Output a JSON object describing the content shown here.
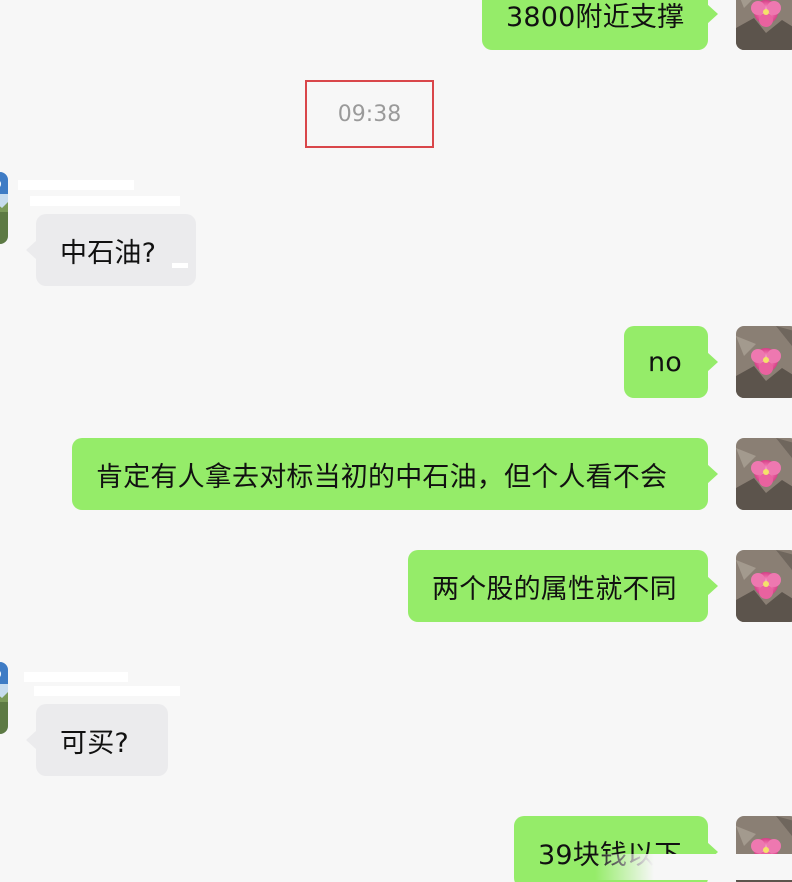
{
  "timestamp": "09:38",
  "messages": [
    {
      "side": "sent",
      "text": "3800附近支撑"
    },
    {
      "side": "recv",
      "text": "中石油?"
    },
    {
      "side": "sent",
      "text": "no"
    },
    {
      "side": "sent",
      "text": "肯定有人拿去对标当初的中石油，但个人看不会"
    },
    {
      "side": "sent",
      "text": "两个股的属性就不同"
    },
    {
      "side": "recv",
      "text": "可买?"
    },
    {
      "side": "sent",
      "text": "39块钱以下"
    }
  ],
  "colors": {
    "background": "#f7f7f7",
    "sent_bubble": "#95ec69",
    "received_bubble": "#ebebed",
    "timestamp_box": "#d9464a",
    "timestamp_text": "#9a9a9a"
  },
  "icons": {
    "own_avatar": "pink-flower-avatar-icon",
    "contact_avatar": "landscape-avatar-icon"
  }
}
